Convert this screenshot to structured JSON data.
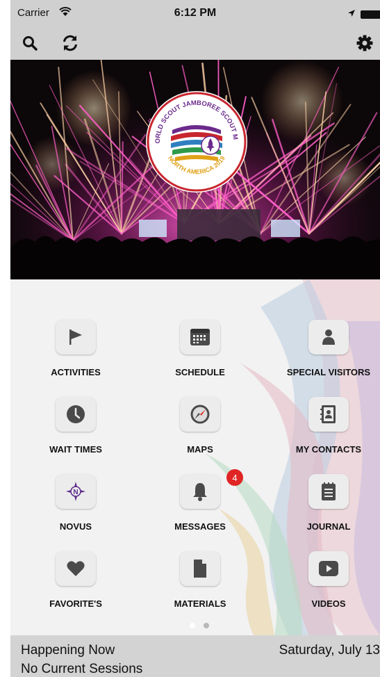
{
  "status_bar": {
    "carrier": "Carrier",
    "time": "6:12 PM"
  },
  "navbar": {
    "icons": [
      "search-icon",
      "refresh-icon",
      "gear-icon"
    ]
  },
  "hero": {
    "logo_text": {
      "top": "24th WORLD SCOUT JAMBOREE SCOUT MONDIAL",
      "bottom": "NORTH AMERICA 2019"
    }
  },
  "menu": {
    "tiles": [
      {
        "label": "ACTIVITIES",
        "icon": "flag-icon"
      },
      {
        "label": "SCHEDULE",
        "icon": "calendar-icon"
      },
      {
        "label": "SPECIAL VISITORS",
        "icon": "person-icon"
      },
      {
        "label": "WAIT TIMES",
        "icon": "clock-icon"
      },
      {
        "label": "MAPS",
        "icon": "compass-icon"
      },
      {
        "label": "MY CONTACTS",
        "icon": "contacts-icon"
      },
      {
        "label": "NOVUS",
        "icon": "novus-icon"
      },
      {
        "label": "MESSAGES",
        "icon": "bell-icon",
        "badge": "4"
      },
      {
        "label": "JOURNAL",
        "icon": "journal-icon"
      },
      {
        "label": "FAVORITE'S",
        "icon": "heart-icon"
      },
      {
        "label": "MATERIALS",
        "icon": "document-icon"
      },
      {
        "label": "VIDEOS",
        "icon": "play-icon"
      }
    ]
  },
  "pager": {
    "pages": 2,
    "current": 1
  },
  "footer": {
    "heading": "Happening Now",
    "status": "No Current Sessions",
    "date": "Saturday, July 13"
  },
  "colors": {
    "bar_bg": "#d0d0d0",
    "tile_bg": "#ececec",
    "icon_gray": "#4a4a4a",
    "badge_red": "#e02525",
    "novus_purple": "#5a2a8a",
    "firework_pink": "#ff4fb8"
  }
}
